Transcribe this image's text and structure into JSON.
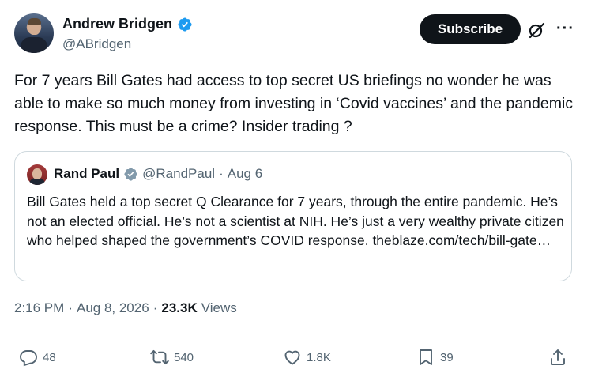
{
  "author": {
    "display_name": "Andrew Bridgen",
    "handle": "@ABridgen",
    "verified": true
  },
  "header": {
    "subscribe_label": "Subscribe",
    "grok_icon": "grok-icon",
    "more_icon": "more-icon"
  },
  "tweet": {
    "text": "For 7 years Bill Gates had access to top secret US briefings no wonder he was able to make so much money from investing in ‘Covid vaccines’ and the pandemic response. This must be a crime? Insider trading ?"
  },
  "quote": {
    "display_name": "Rand Paul",
    "handle": "@RandPaul",
    "separator": "·",
    "date": "Aug 6",
    "verified": true,
    "text": "Bill Gates held a top secret Q Clearance for 7 years, through the entire pandemic. He’s not an elected official. He’s not a scientist at NIH. He’s just a very wealthy private citizen who helped shaped the government’s COVID response. theblaze.com/tech/bill-gate…"
  },
  "meta": {
    "time": "2:16 PM",
    "sep1": "·",
    "date": "Aug 8, 2026",
    "sep2": "·",
    "views_count": "23.3K",
    "views_label": "Views"
  },
  "actions": {
    "replies": "48",
    "reposts": "540",
    "likes": "1.8K",
    "bookmarks": "39"
  },
  "colors": {
    "text_primary": "#0f1419",
    "text_secondary": "#536471",
    "verified_blue": "#1d9bf0",
    "border": "#cfd9de",
    "subscribe_bg": "#0f1419"
  }
}
